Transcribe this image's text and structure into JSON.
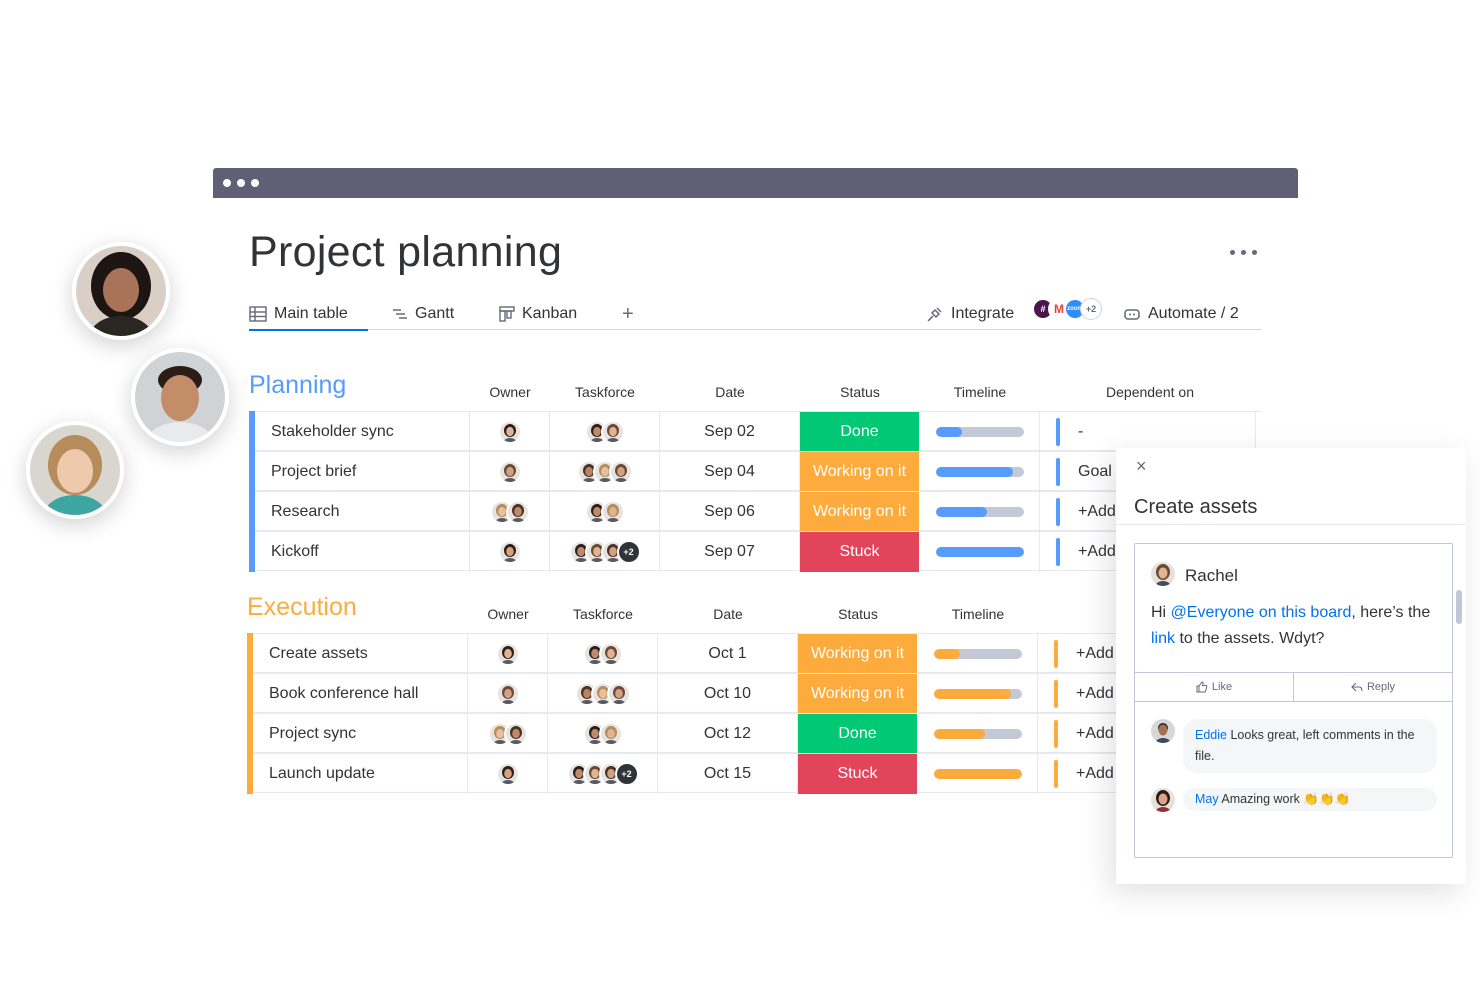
{
  "board": {
    "title": "Project planning",
    "tabs": [
      {
        "label": "Main table",
        "icon": "table-icon"
      },
      {
        "label": "Gantt",
        "icon": "gantt-icon"
      },
      {
        "label": "Kanban",
        "icon": "kanban-icon"
      }
    ],
    "add_tab": "+",
    "integrate_label": "Integrate",
    "integrations_more": "+2",
    "zoom_label": "zoom",
    "automate_label": "Automate / 2"
  },
  "planning": {
    "title": "Planning",
    "color": "#579bfc",
    "columns": [
      "Owner",
      "Taskforce",
      "Date",
      "Status",
      "Timeline",
      "Dependent on"
    ],
    "rows": [
      {
        "name": "Stakeholder sync",
        "date": "Sep 02",
        "status": "Done",
        "status_color": "#00c875",
        "progress": 0.3,
        "dependent": "-"
      },
      {
        "name": "Project brief",
        "date": "Sep 04",
        "status": "Working on it",
        "status_color": "#fdab3d",
        "progress": 0.88,
        "dependent": "Goal"
      },
      {
        "name": "Research",
        "date": "Sep 06",
        "status": "Working on it",
        "status_color": "#fdab3d",
        "progress": 0.58,
        "dependent": "+Add"
      },
      {
        "name": "Kickoff",
        "date": "Sep 07",
        "status": "Stuck",
        "status_color": "#e2445c",
        "progress": 1.0,
        "dependent": "+Add"
      }
    ]
  },
  "execution": {
    "title": "Execution",
    "color": "#fdab3d",
    "columns": [
      "Owner",
      "Taskforce",
      "Date",
      "Status",
      "Timeline"
    ],
    "rows": [
      {
        "name": "Create assets",
        "date": "Oct 1",
        "status": "Working on it",
        "status_color": "#fdab3d",
        "progress": 0.3,
        "dependent": "+Add"
      },
      {
        "name": "Book conference hall",
        "date": "Oct 10",
        "status": "Working on it",
        "status_color": "#fdab3d",
        "progress": 0.88,
        "dependent": "+Add"
      },
      {
        "name": "Project sync",
        "date": "Oct 12",
        "status": "Done",
        "status_color": "#00c875",
        "progress": 0.58,
        "dependent": "+Add"
      },
      {
        "name": "Launch update",
        "date": "Oct 15",
        "status": "Stuck",
        "status_color": "#e2445c",
        "progress": 1.0,
        "dependent": "+Add"
      }
    ]
  },
  "taskforce_more": "+2",
  "panel": {
    "close": "×",
    "title": "Create assets",
    "author": "Rachel",
    "msg_pre": "Hi ",
    "msg_mention": "@Everyone on this board",
    "msg_mid": ", here’s the ",
    "msg_link": "link",
    "msg_post": " to the assets. Wdyt?",
    "like": "Like",
    "reply": "Reply",
    "replies": [
      {
        "author": "Eddie",
        "text": " Looks great, left comments in the file."
      },
      {
        "author": "May",
        "text": " Amazing work 👏👏👏"
      }
    ]
  }
}
